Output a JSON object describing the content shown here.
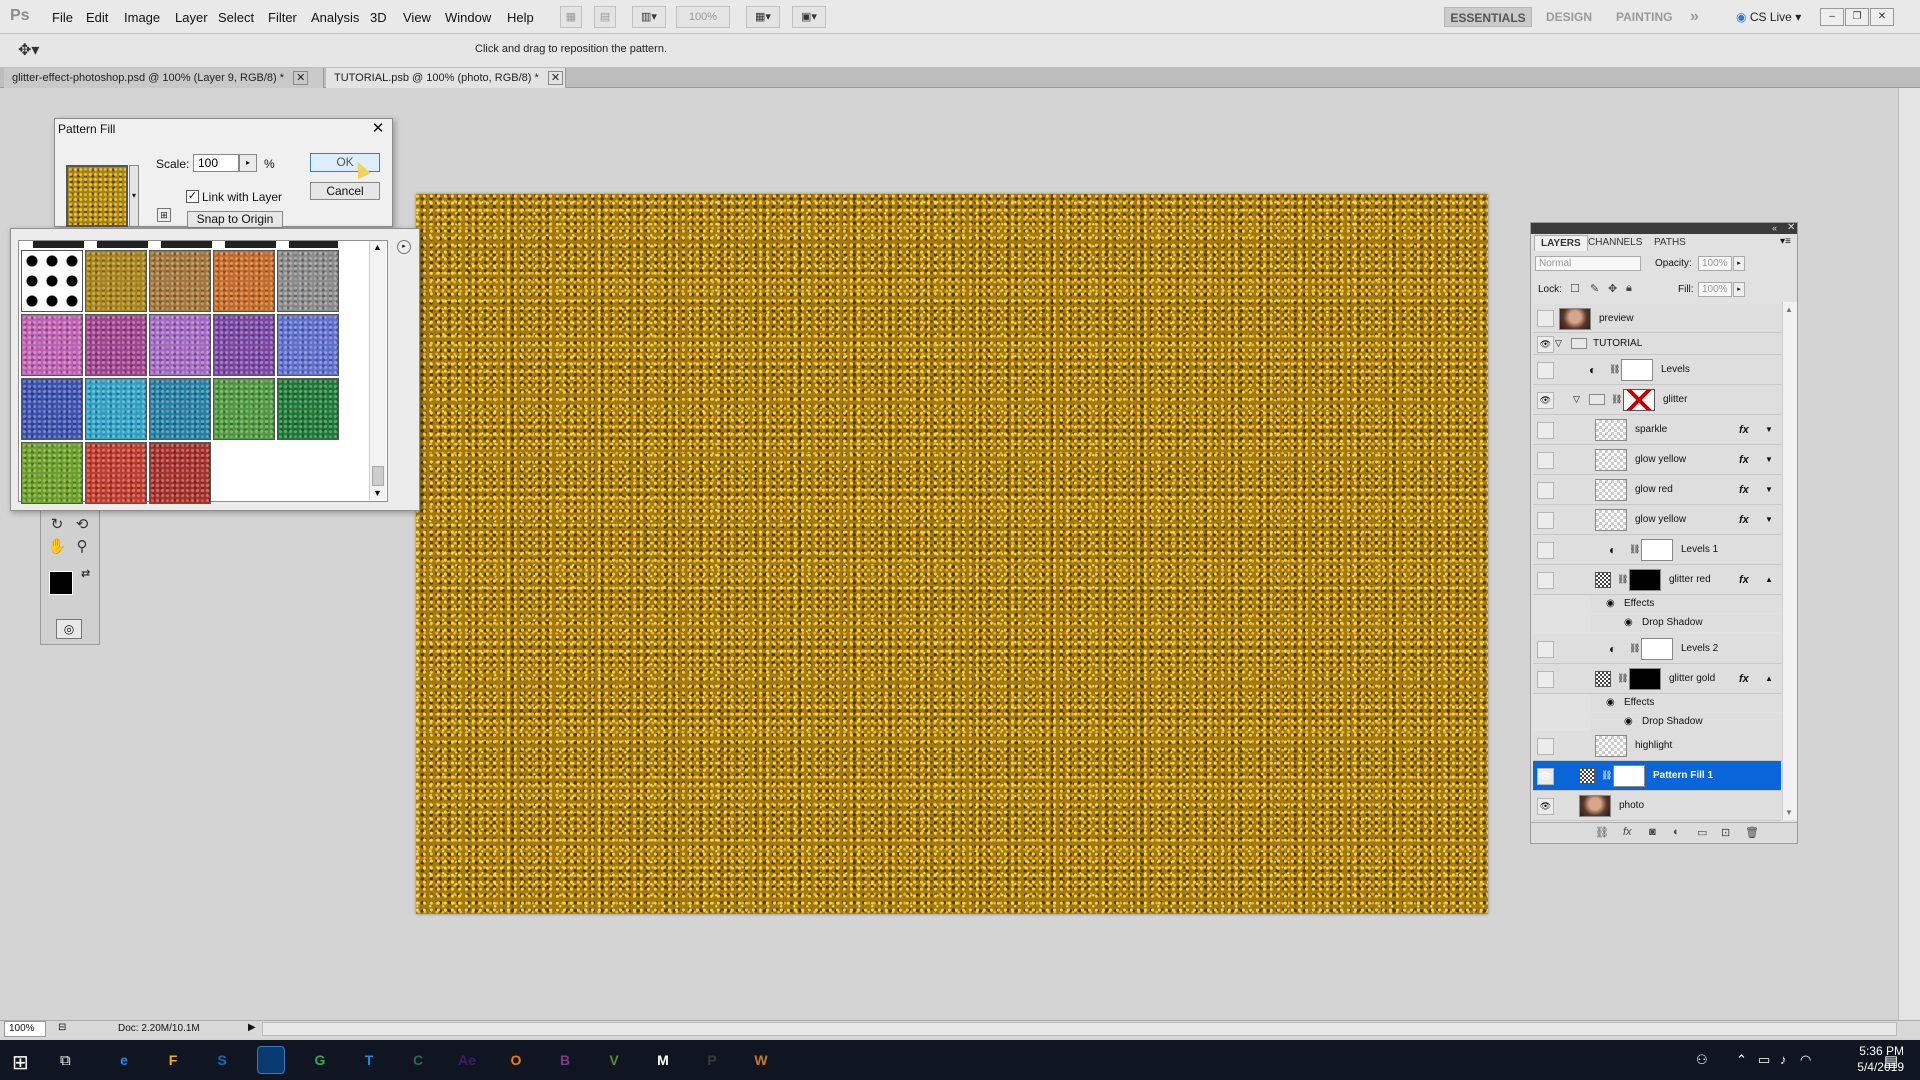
{
  "app": {
    "logo": "Ps",
    "menus": [
      "File",
      "Edit",
      "Image",
      "Layer",
      "Select",
      "Filter",
      "Analysis",
      "3D",
      "View",
      "Window",
      "Help"
    ],
    "zoom_select": "100%",
    "workspaces": [
      "ESSENTIALS",
      "DESIGN",
      "PAINTING"
    ],
    "more_glyph": "»",
    "cs_live": "CS Live",
    "window_controls": [
      "–",
      "❐",
      "✕"
    ]
  },
  "options_bar": {
    "hint": "Click and drag to reposition the pattern."
  },
  "tabs": [
    {
      "label": "glitter-effect-photoshop.psd @ 100% (Layer 9, RGB/8) *",
      "close": "✕"
    },
    {
      "label": "TUTORIAL.psb @ 100% (photo, RGB/8) *",
      "close": "✕"
    }
  ],
  "status": {
    "zoom": "100%",
    "doc": "Doc: 2.20M/10.1M"
  },
  "dialog": {
    "title": "Pattern Fill",
    "close": "✕",
    "scale_label": "Scale:",
    "scale_value": "100",
    "scale_unit": "%",
    "link_label": "Link with Layer",
    "link_checked": "✓",
    "snap_label": "Snap to Origin",
    "ok": "OK",
    "cancel": "Cancel"
  },
  "picker": {
    "swatch_colors": [
      [
        "#ffffff",
        "#a98312",
        "#a47536",
        "#c86a24",
        "#8a8a8a"
      ],
      [
        "#c05fb1",
        "#a2418f",
        "#a468c5",
        "#7a45a6",
        "#5e6fd0"
      ],
      [
        "#3a50b0",
        "#2ba3c6",
        "#2280a6",
        "#4d9a3c",
        "#1c7a36"
      ],
      [
        "#6aa024",
        "#c23a2c",
        "#a82f28"
      ]
    ]
  },
  "layers_panel": {
    "tabs": [
      "LAYERS",
      "CHANNELS",
      "PATHS"
    ],
    "blend_mode": "Normal",
    "opacity_label": "Opacity:",
    "opacity": "100%",
    "lock_label": "Lock:",
    "fill_label": "Fill:",
    "fill": "100%",
    "layers": [
      {
        "name": "preview"
      },
      {
        "name": "TUTORIAL"
      },
      {
        "name": "Levels"
      },
      {
        "name": "glitter"
      },
      {
        "name": "sparkle",
        "fx": "fx"
      },
      {
        "name": "glow yellow",
        "fx": "fx"
      },
      {
        "name": "glow red",
        "fx": "fx"
      },
      {
        "name": "glow yellow",
        "fx": "fx"
      },
      {
        "name": "Levels 1"
      },
      {
        "name": "glitter red",
        "fx": "fx",
        "effects": "Effects",
        "effect": "Drop Shadow"
      },
      {
        "name": "Levels 2"
      },
      {
        "name": "glitter gold",
        "fx": "fx",
        "effects": "Effects",
        "effect": "Drop Shadow"
      },
      {
        "name": "highlight"
      },
      {
        "name": "Pattern Fill 1"
      },
      {
        "name": "photo"
      }
    ]
  },
  "taskbar": {
    "time": "5:36 PM",
    "date": "5/4/2019",
    "apps": [
      "e",
      "F",
      "S",
      "Ps",
      "G",
      "T",
      "C",
      "Ae",
      "O",
      "B",
      "V",
      "M",
      "P",
      "W"
    ]
  }
}
